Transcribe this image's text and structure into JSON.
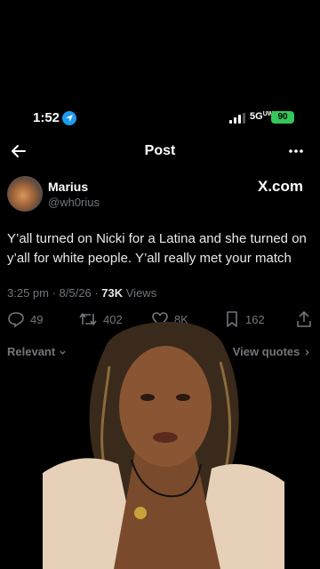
{
  "status_bar": {
    "time": "1:52",
    "network": "5G",
    "network_suffix": "UW",
    "battery": "90",
    "location_icon": "location-arrow-icon",
    "signal_icon": "cellular-signal-icon"
  },
  "nav": {
    "title": "Post",
    "back_icon": "back-arrow-icon",
    "more_icon": "more-dots-icon"
  },
  "author": {
    "name": "Marius",
    "handle": "@wh0rius",
    "watermark": "X.com"
  },
  "tweet": {
    "text": "Y’all turned on Nicki for a Latina and she turned on y’all for white people. Y’all really met your match",
    "time": "3:25 pm",
    "date": "8/5/26",
    "views_count": "73K",
    "views_label": "Views"
  },
  "actions": {
    "replies": "49",
    "reposts": "402",
    "likes": "8K",
    "bookmarks": "162"
  },
  "replies_bar": {
    "sort_label": "Relevant",
    "quotes_label": "View quotes"
  },
  "colors": {
    "background": "#000000",
    "muted": "#71767b",
    "text": "#e7e9ea",
    "accent": "#1d9bf0",
    "battery": "#34c759"
  }
}
